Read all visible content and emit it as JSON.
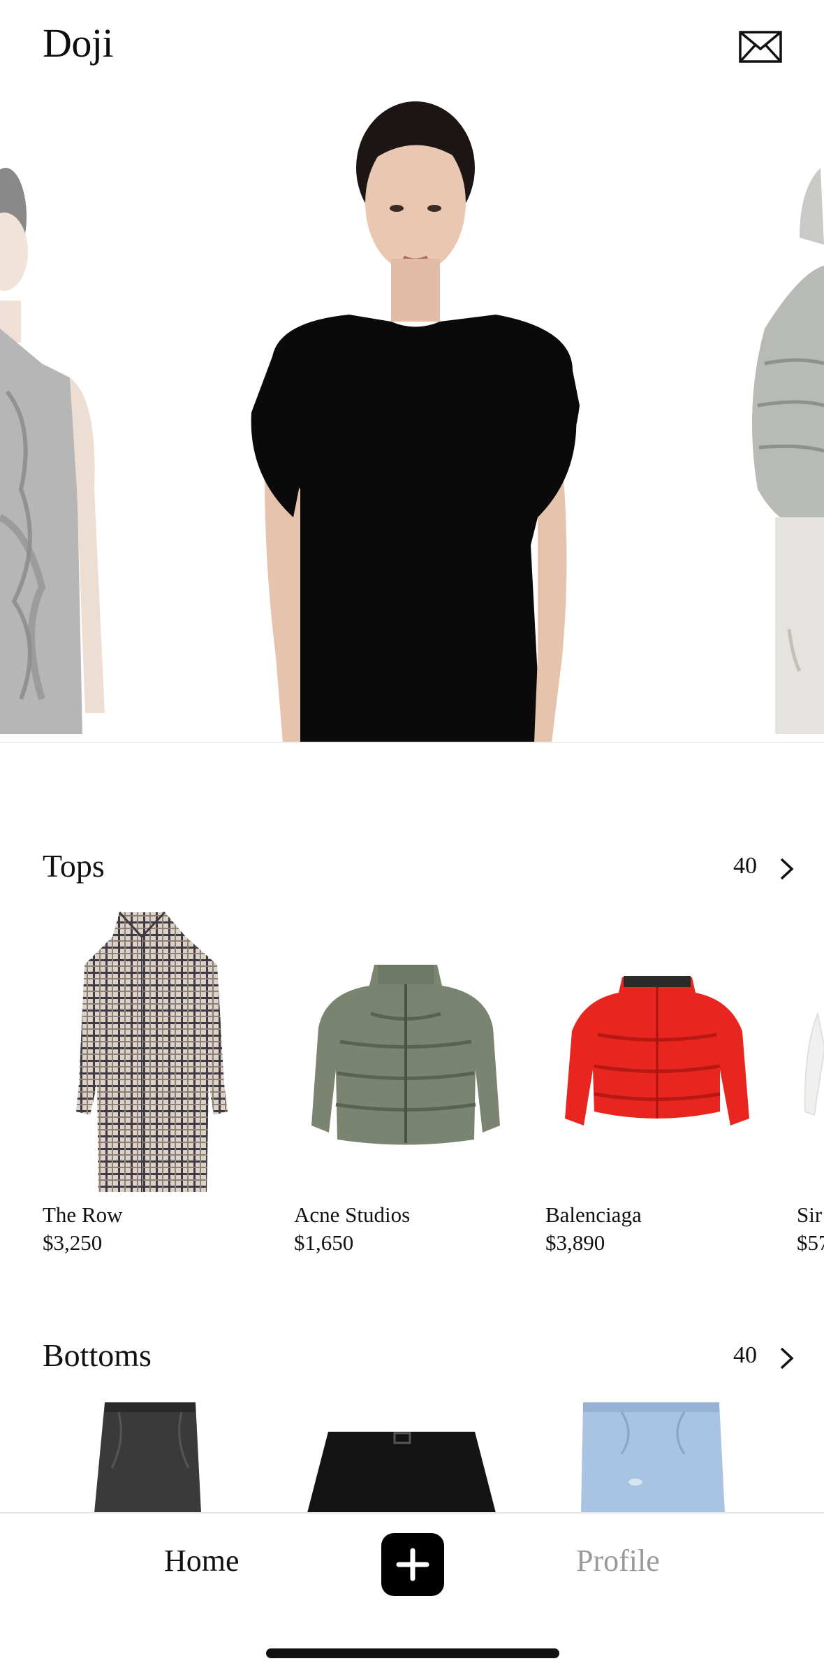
{
  "app": {
    "title": "Doji"
  },
  "header": {
    "inbox_icon": "envelope-icon"
  },
  "hero": {
    "items": [
      {
        "image": "grey-printed-sleeveless-dress",
        "dominant_color": "#8a8a8a"
      },
      {
        "image": "black-draped-dress",
        "dominant_color": "#0c0c0c"
      },
      {
        "image": "sage-puffer-jacket",
        "dominant_color": "#b6b8b2"
      }
    ]
  },
  "sections": [
    {
      "title": "Tops",
      "count": "40",
      "chevron_icon": "chevron-right-icon",
      "items": [
        {
          "brand": "The Row",
          "price": "$3,250",
          "image": "plaid-coat",
          "color": "#c9bfb4"
        },
        {
          "brand": "Acne Studios",
          "price": "$1,650",
          "image": "olive-puffer-jacket",
          "color": "#7b8470"
        },
        {
          "brand": "Balenciaga",
          "price": "$3,890",
          "image": "red-puffer-jacket",
          "color": "#e8261f"
        },
        {
          "brand": "Sir",
          "price": "$57",
          "image": "white-top",
          "color": "#f2f2f2"
        }
      ]
    },
    {
      "title": "Bottoms",
      "count": "40",
      "chevron_icon": "chevron-right-icon",
      "items": [
        {
          "image": "black-denim-shorts",
          "color": "#3a3a3a"
        },
        {
          "image": "black-belted-skirt",
          "color": "#141414"
        },
        {
          "image": "light-wash-denim-shorts",
          "color": "#a9c4e2"
        }
      ]
    }
  ],
  "tabbar": {
    "home_label": "Home",
    "add_icon": "plus-icon",
    "profile_label": "Profile"
  }
}
